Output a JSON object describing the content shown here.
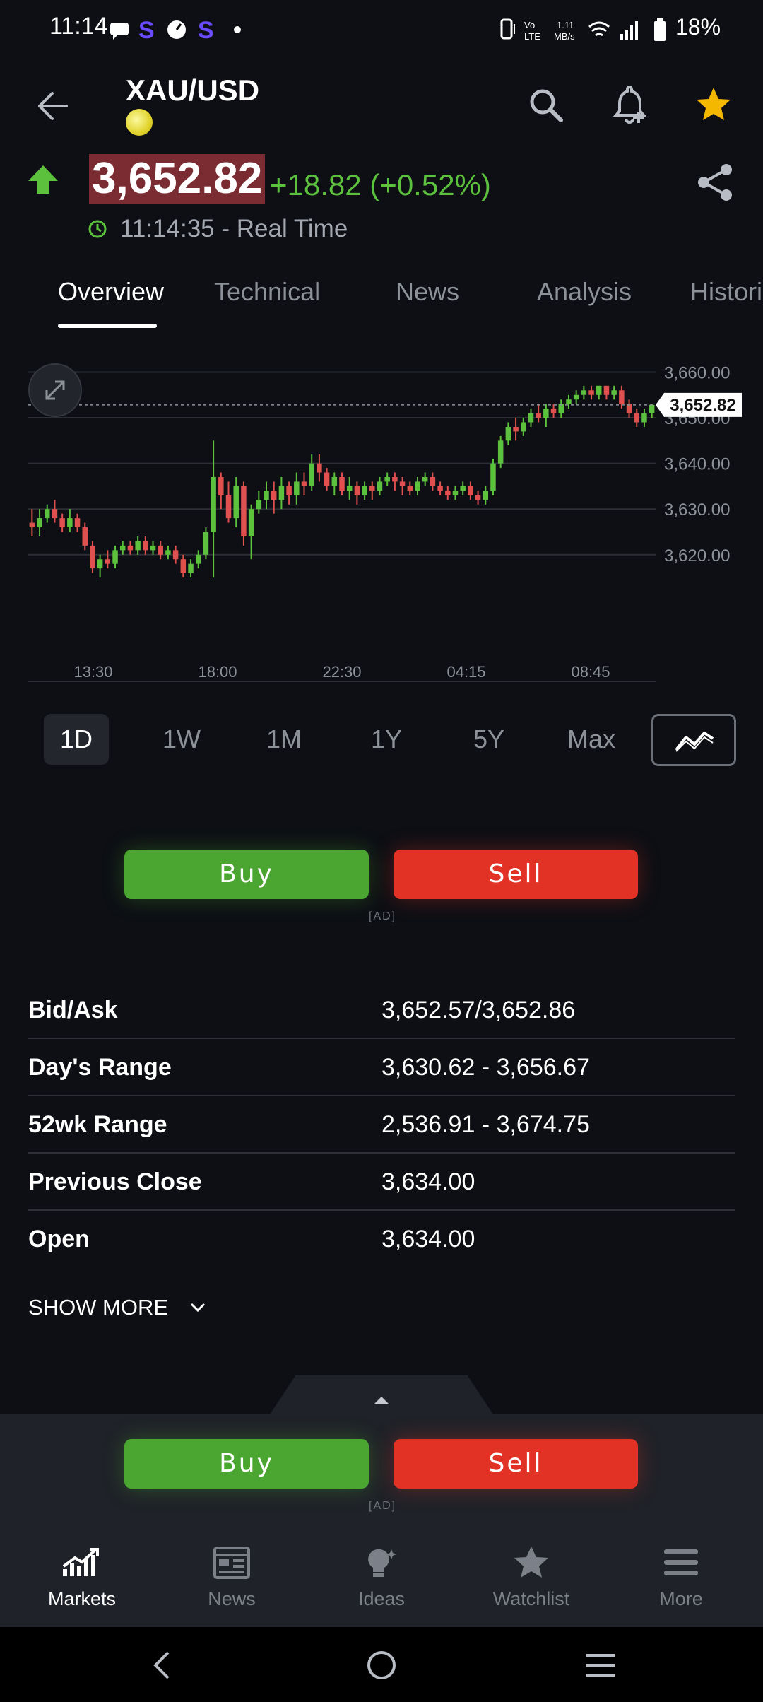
{
  "status_bar": {
    "time": "11:14",
    "battery": "18%",
    "net_speed": "1.11 MB/s",
    "network": "VoLTE"
  },
  "header": {
    "symbol": "XAU/USD"
  },
  "quote": {
    "price": "3,652.82",
    "change": "+18.82 (+0.52%)",
    "time": "11:14:35 - Real Time",
    "up_color": "#5cc13d"
  },
  "tabs": [
    {
      "label": "Overview",
      "active": true
    },
    {
      "label": "Technical"
    },
    {
      "label": "News"
    },
    {
      "label": "Analysis"
    },
    {
      "label": "Histori"
    }
  ],
  "chart_data": {
    "type": "candlestick",
    "current_price_label": "3,652.82",
    "y_ticks": [
      "3,660.00",
      "3,650.00",
      "3,640.00",
      "3,630.00",
      "3,620.00"
    ],
    "x_ticks": [
      "13:30",
      "18:00",
      "22:30",
      "04:15",
      "08:45"
    ],
    "ylim": [
      3613,
      3661
    ],
    "candles": [
      [
        3627,
        3626,
        3630,
        3624
      ],
      [
        3626,
        3628,
        3630,
        3624
      ],
      [
        3628,
        3630,
        3631,
        3627
      ],
      [
        3630,
        3628,
        3632,
        3627
      ],
      [
        3628,
        3626,
        3629,
        3625
      ],
      [
        3626,
        3628,
        3630,
        3625
      ],
      [
        3628,
        3626,
        3629,
        3625
      ],
      [
        3626,
        3622,
        3627,
        3621
      ],
      [
        3622,
        3617,
        3623,
        3616
      ],
      [
        3617,
        3619,
        3620,
        3615
      ],
      [
        3619,
        3618,
        3621,
        3617
      ],
      [
        3618,
        3621,
        3622,
        3617
      ],
      [
        3621,
        3622,
        3623,
        3620
      ],
      [
        3622,
        3621,
        3623,
        3620
      ],
      [
        3621,
        3623,
        3624,
        3620
      ],
      [
        3623,
        3621,
        3624,
        3620
      ],
      [
        3621,
        3622,
        3623,
        3620
      ],
      [
        3622,
        3620,
        3623,
        3619
      ],
      [
        3620,
        3621,
        3622,
        3619
      ],
      [
        3621,
        3619,
        3622,
        3618
      ],
      [
        3619,
        3616,
        3620,
        3615
      ],
      [
        3616,
        3618,
        3619,
        3615
      ],
      [
        3618,
        3620,
        3621,
        3617
      ],
      [
        3620,
        3625,
        3626,
        3619
      ],
      [
        3625,
        3637,
        3645,
        3615
      ],
      [
        3637,
        3633,
        3638,
        3630
      ],
      [
        3633,
        3628,
        3636,
        3627
      ],
      [
        3628,
        3635,
        3637,
        3626
      ],
      [
        3635,
        3624,
        3636,
        3622
      ],
      [
        3624,
        3630,
        3631,
        3619
      ],
      [
        3630,
        3632,
        3634,
        3629
      ],
      [
        3632,
        3634,
        3636,
        3630
      ],
      [
        3634,
        3632,
        3636,
        3629
      ],
      [
        3632,
        3635,
        3637,
        3630
      ],
      [
        3635,
        3633,
        3636,
        3631
      ],
      [
        3633,
        3636,
        3638,
        3631
      ],
      [
        3636,
        3635,
        3638,
        3633
      ],
      [
        3635,
        3640,
        3642,
        3634
      ],
      [
        3640,
        3638,
        3642,
        3636
      ],
      [
        3638,
        3635,
        3639,
        3634
      ],
      [
        3635,
        3637,
        3638,
        3633
      ],
      [
        3637,
        3634,
        3638,
        3633
      ],
      [
        3634,
        3635,
        3637,
        3632
      ],
      [
        3635,
        3633,
        3636,
        3631
      ],
      [
        3633,
        3635,
        3636,
        3632
      ],
      [
        3635,
        3634,
        3636,
        3632
      ],
      [
        3634,
        3636,
        3637,
        3633
      ],
      [
        3636,
        3637,
        3638,
        3635
      ],
      [
        3637,
        3636,
        3638,
        3634
      ],
      [
        3636,
        3635,
        3637,
        3633
      ],
      [
        3635,
        3634,
        3636,
        3633
      ],
      [
        3634,
        3636,
        3637,
        3633
      ],
      [
        3636,
        3637,
        3638,
        3635
      ],
      [
        3637,
        3635,
        3638,
        3634
      ],
      [
        3635,
        3634,
        3636,
        3633
      ],
      [
        3634,
        3633,
        3635,
        3632
      ],
      [
        3633,
        3634,
        3635,
        3632
      ],
      [
        3634,
        3635,
        3636,
        3633
      ],
      [
        3635,
        3633,
        3636,
        3632
      ],
      [
        3633,
        3632,
        3634,
        3631
      ],
      [
        3632,
        3634,
        3635,
        3631
      ],
      [
        3634,
        3640,
        3641,
        3633
      ],
      [
        3640,
        3645,
        3646,
        3639
      ],
      [
        3645,
        3648,
        3649,
        3644
      ],
      [
        3648,
        3647,
        3650,
        3645
      ],
      [
        3647,
        3649,
        3650,
        3646
      ],
      [
        3649,
        3651,
        3652,
        3648
      ],
      [
        3651,
        3650,
        3653,
        3649
      ],
      [
        3650,
        3652,
        3653,
        3648
      ],
      [
        3652,
        3651,
        3653,
        3650
      ],
      [
        3651,
        3653,
        3654,
        3650
      ],
      [
        3653,
        3654,
        3655,
        3652
      ],
      [
        3654,
        3655,
        3656,
        3653
      ],
      [
        3655,
        3656,
        3657,
        3654
      ],
      [
        3656,
        3655,
        3657,
        3654
      ],
      [
        3655,
        3657,
        3657,
        3654
      ],
      [
        3657,
        3655,
        3657,
        3654
      ],
      [
        3655,
        3656,
        3657,
        3654
      ],
      [
        3656,
        3653,
        3657,
        3652
      ],
      [
        3653,
        3651,
        3654,
        3650
      ],
      [
        3651,
        3649,
        3652,
        3648
      ],
      [
        3649,
        3651,
        3652,
        3648
      ],
      [
        3651,
        3652.82,
        3653,
        3650
      ]
    ]
  },
  "ranges": [
    {
      "label": "1D",
      "active": true
    },
    {
      "label": "1W"
    },
    {
      "label": "1M"
    },
    {
      "label": "1Y"
    },
    {
      "label": "5Y"
    },
    {
      "label": "Max"
    }
  ],
  "trade": {
    "buy": "Buy",
    "sell": "Sell",
    "ad": "[AD]"
  },
  "stats": [
    {
      "label": "Bid/Ask",
      "value": "3,652.57/3,652.86"
    },
    {
      "label": "Day's Range",
      "value": "3,630.62 - 3,656.67"
    },
    {
      "label": "52wk Range",
      "value": "2,536.91 - 3,674.75"
    },
    {
      "label": "Previous Close",
      "value": "3,634.00"
    },
    {
      "label": "Open",
      "value": "3,634.00"
    }
  ],
  "show_more": "SHOW MORE",
  "bottom_nav": [
    {
      "label": "Markets",
      "icon": "markets-icon",
      "active": true
    },
    {
      "label": "News",
      "icon": "news-icon"
    },
    {
      "label": "Ideas",
      "icon": "ideas-icon"
    },
    {
      "label": "Watchlist",
      "icon": "star-icon"
    },
    {
      "label": "More",
      "icon": "menu-icon"
    }
  ],
  "colors": {
    "green": "#4aa630",
    "red": "#e23125",
    "price_bg": "#7a2c32",
    "star": "#f5b800"
  }
}
